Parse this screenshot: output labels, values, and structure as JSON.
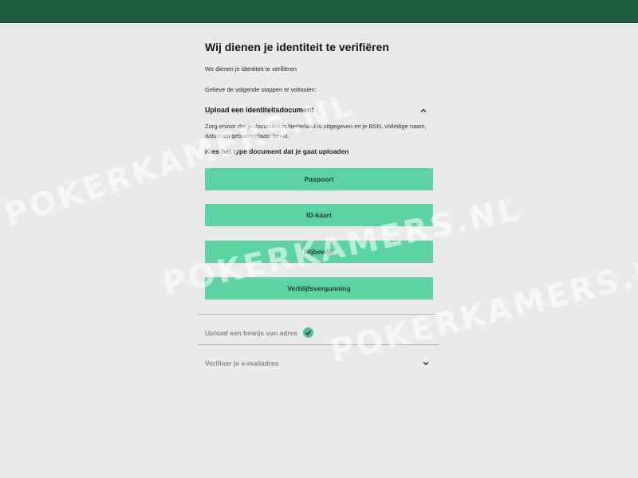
{
  "header": {
    "bar_color": "#1e5b3f"
  },
  "page": {
    "title": "Wij dienen je identiteit te verifiëren",
    "intro": "We dienen je identiteit te verifiëren",
    "instructions": "Gelieve de volgende stappen te voltooien:"
  },
  "upload_id": {
    "title": "Upload een identiteitsdocument",
    "expanded": true,
    "description": "Zorg ervoor dat je document in Nederland is uitgegeven en je BSN, volledige naam, datum en geboorteplaats bevat.",
    "choose_label": "Kies het type document dat je gaat uploaden",
    "documents": [
      {
        "label": "Paspoort"
      },
      {
        "label": "ID-kaart"
      },
      {
        "label": "Rijbewijs"
      },
      {
        "label": "Verblijfsvergunning"
      }
    ],
    "button_color": "#5dd3a4"
  },
  "upload_address": {
    "title": "Upload een bewijs van adres",
    "status": "completed",
    "status_icon": "check-circle-icon",
    "status_color": "#4cc48f"
  },
  "verify_email": {
    "title": "Verifieer je e-mailadres",
    "expanded": false
  },
  "watermark": {
    "text": "POKERKAMERS.NL"
  }
}
